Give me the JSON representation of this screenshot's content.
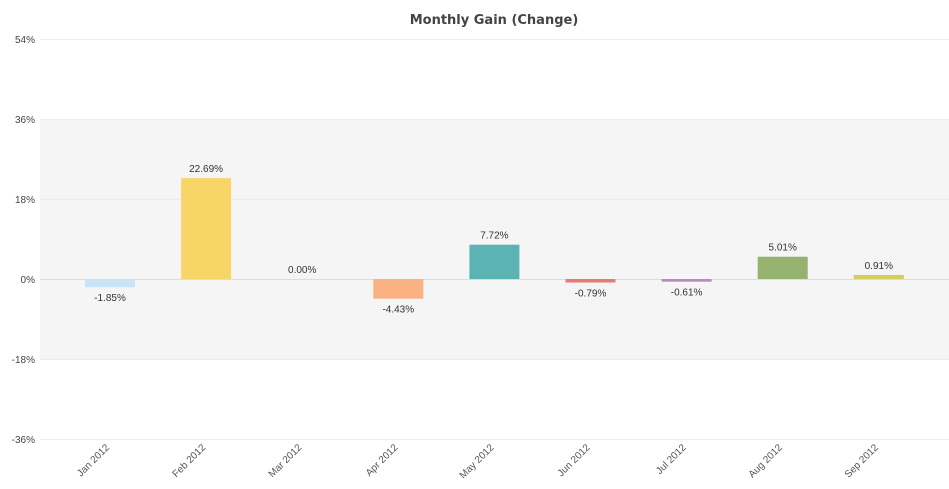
{
  "chart_data": {
    "type": "bar",
    "title": "Monthly Gain (Change)",
    "xlabel": "",
    "ylabel": "",
    "categories": [
      "Jan 2012",
      "Feb 2012",
      "Mar 2012",
      "Apr 2012",
      "May 2012",
      "Jun 2012",
      "Jul 2012",
      "Aug 2012",
      "Sep 2012"
    ],
    "values": [
      -1.85,
      22.69,
      0.0,
      -4.43,
      7.72,
      -0.79,
      -0.61,
      5.01,
      0.91
    ],
    "data_labels": [
      "-1.85%",
      "22.69%",
      "0.00%",
      "-4.43%",
      "7.72%",
      "-0.79%",
      "-0.61%",
      "5.01%",
      "0.91%"
    ],
    "colors": [
      "#c9e4f7",
      "#f7d566",
      "#cccccc",
      "#fbb283",
      "#5bb4b3",
      "#e57a76",
      "#b889c3",
      "#95b26e",
      "#d4cf5d"
    ],
    "ylim": [
      -36,
      54
    ],
    "yticks": [
      54,
      36,
      18,
      0,
      -18,
      -36
    ],
    "ytick_labels": [
      "54%",
      "36%",
      "18%",
      "0%",
      "-18%",
      "-36%"
    ],
    "plot_band": [
      -18,
      36
    ],
    "plot_band_color": "#f5f5f5",
    "grid": true,
    "legend": "none"
  }
}
